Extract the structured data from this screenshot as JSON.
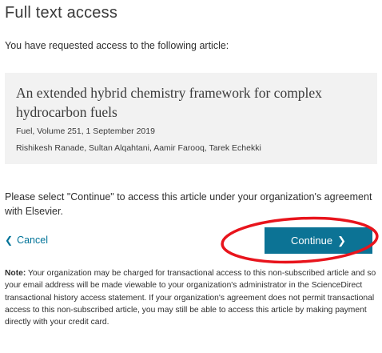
{
  "page_title": "Full text access",
  "intro": "You have requested access to the following article:",
  "article": {
    "title": "An extended hybrid chemistry framework for complex hydrocarbon fuels",
    "source": "Fuel, Volume 251, 1 September 2019",
    "authors": "Rishikesh Ranade, Sultan Alqahtani, Aamir Farooq, Tarek Echekki"
  },
  "select_text": "Please select \"Continue\" to access this article under your organization's agreement with Elsevier.",
  "actions": {
    "cancel_label": "Cancel",
    "continue_label": "Continue"
  },
  "note": {
    "label": "Note:",
    "text": "Your organization may be charged for transactional access to this non-subscribed article and so your email address will be made viewable to your organization's administrator in the ScienceDirect transactional history access statement. If your organization's agreement does not permit transactional access to this non-subscribed article, you may still be able to access this article by making payment directly with your credit card."
  },
  "colors": {
    "accent": "#0c7395",
    "link": "#007398",
    "annotation": "#e8141c",
    "panel_bg": "#f2f2f2"
  }
}
